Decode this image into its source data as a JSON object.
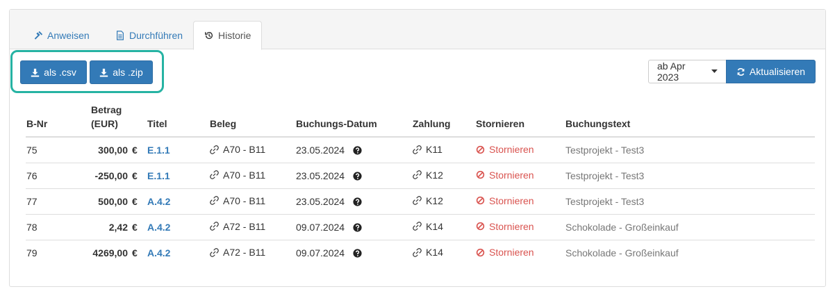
{
  "tabs": [
    {
      "label": "Anweisen",
      "icon": "gavel-icon"
    },
    {
      "label": "Durchführen",
      "icon": "document-icon"
    },
    {
      "label": "Historie",
      "icon": "history-icon"
    }
  ],
  "toolbar": {
    "csv_label": "als .csv",
    "zip_label": "als .zip",
    "date_filter": "ab Apr 2023",
    "refresh_label": "Aktualisieren"
  },
  "table": {
    "headers": {
      "nr": "B-Nr",
      "betrag_1": "Betrag",
      "betrag_2": "(EUR)",
      "titel": "Titel",
      "beleg": "Beleg",
      "datum": "Buchungs-Datum",
      "zahlung": "Zahlung",
      "storno": "Stornieren",
      "text": "Buchungstext"
    },
    "rows": [
      {
        "nr": "75",
        "betrag": "300,00",
        "currency": "€",
        "titel": "E.1.1",
        "beleg": "A70 - B11",
        "datum": "23.05.2024",
        "zahlung": "K11",
        "storno": "Stornieren",
        "text": "Testprojekt - Test3"
      },
      {
        "nr": "76",
        "betrag": "-250,00",
        "currency": "€",
        "titel": "E.1.1",
        "beleg": "A70 - B11",
        "datum": "23.05.2024",
        "zahlung": "K12",
        "storno": "Stornieren",
        "text": "Testprojekt - Test3"
      },
      {
        "nr": "77",
        "betrag": "500,00",
        "currency": "€",
        "titel": "A.4.2",
        "beleg": "A70 - B11",
        "datum": "23.05.2024",
        "zahlung": "K12",
        "storno": "Stornieren",
        "text": "Testprojekt - Test3"
      },
      {
        "nr": "78",
        "betrag": "2,42",
        "currency": "€",
        "titel": "A.4.2",
        "beleg": "A72 - B11",
        "datum": "09.07.2024",
        "zahlung": "K14",
        "storno": "Stornieren",
        "text": "Schokolade - Großeinkauf"
      },
      {
        "nr": "79",
        "betrag": "4269,00",
        "currency": "€",
        "titel": "A.4.2",
        "beleg": "A72 - B11",
        "datum": "09.07.2024",
        "zahlung": "K14",
        "storno": "Stornieren",
        "text": "Schokolade - Großeinkauf"
      }
    ]
  },
  "colors": {
    "primary": "#337ab7",
    "danger": "#d9534f",
    "highlight": "#26b3a3"
  }
}
